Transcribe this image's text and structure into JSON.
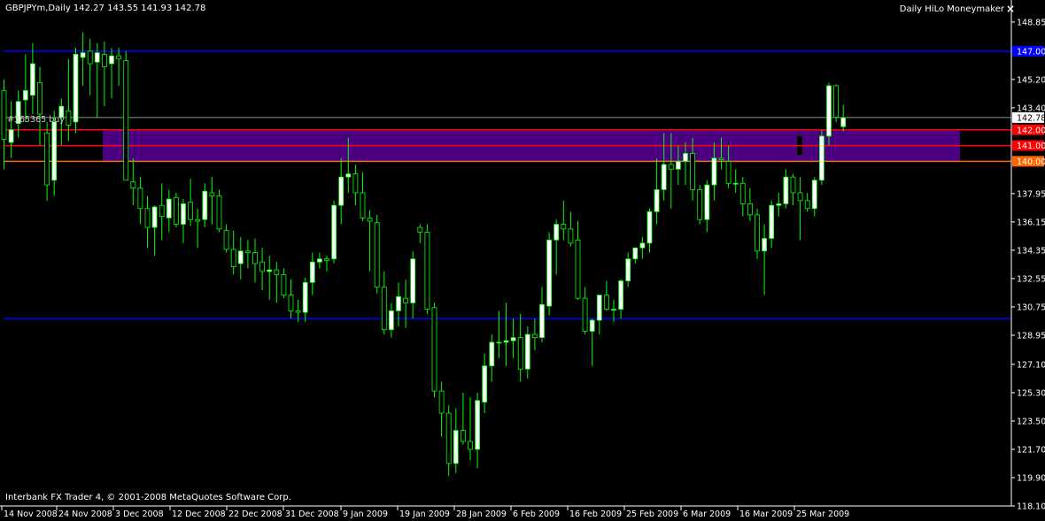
{
  "header": {
    "symbol_info": "GBPJPYm,Daily  142.27 143.55 141.93 142.78",
    "indicator_name": "Daily HiLo Moneymaker",
    "close_icon": "×"
  },
  "footer": {
    "copyright": "Interbank FX Trader 4, © 2001-2008 MetaQuotes Software Corp."
  },
  "trade_label": "#365365 buy",
  "colors": {
    "background": "#000000",
    "axis": "#ffffff",
    "bull_body": "#ffffff",
    "bear_body": "#000000",
    "candle_outline": "#00ff00",
    "level_blue": "#0000ff",
    "level_red": "#ff0000",
    "level_orange": "#ff6600",
    "zone_fill": "#4b0082",
    "current_price_line": "#c0c0c0"
  },
  "chart_data": {
    "type": "candlestick",
    "symbol": "GBPJPYm",
    "timeframe": "Daily",
    "ylim": [
      118.1,
      149.8
    ],
    "y_ticks": [
      "148.85",
      "147.00",
      "145.20",
      "143.40",
      "142.78",
      "142.00",
      "141.00",
      "140.00",
      "137.95",
      "136.15",
      "134.35",
      "132.55",
      "130.75",
      "128.95",
      "127.10",
      "125.30",
      "123.50",
      "121.70",
      "119.90",
      "118.10"
    ],
    "x_tick_labels": [
      "14 Nov 2008",
      "24 Nov 2008",
      "3 Dec 2008",
      "12 Dec 2008",
      "22 Dec 2008",
      "31 Dec 2008",
      "9 Jan 2009",
      "19 Jan 2009",
      "28 Jan 2009",
      "6 Feb 2009",
      "16 Feb 2009",
      "25 Feb 2009",
      "6 Mar 2009",
      "16 Mar 2009",
      "25 Mar 2009"
    ],
    "horizontal_levels": [
      {
        "price": 147.0,
        "label": "147.00",
        "color": "#0000ff"
      },
      {
        "price": 142.0,
        "label": "142.00",
        "color": "#ff0000"
      },
      {
        "price": 141.0,
        "label": "141.00",
        "color": "#ff0000"
      },
      {
        "price": 140.0,
        "label": "140.00",
        "color": "#ff6600"
      },
      {
        "price": 130.0,
        "label": "130.00",
        "color": "#0000ff"
      }
    ],
    "zone": {
      "from_price": 140.0,
      "to_price": 142.0
    },
    "current_price": 142.78,
    "ohlc": [
      [
        144.5,
        145.2,
        139.5,
        141.4
      ],
      [
        141.2,
        143.8,
        140.2,
        142.0
      ],
      [
        142.4,
        144.5,
        141.5,
        143.8
      ],
      [
        143.9,
        146.8,
        142.5,
        144.5
      ],
      [
        144.2,
        147.5,
        143.0,
        146.2
      ],
      [
        145.0,
        146.0,
        141.0,
        143.0
      ],
      [
        141.8,
        142.5,
        137.5,
        138.5
      ],
      [
        138.8,
        143.2,
        137.8,
        142.5
      ],
      [
        142.8,
        144.0,
        141.0,
        143.5
      ],
      [
        143.2,
        146.5,
        141.3,
        142.3
      ],
      [
        142.5,
        147.2,
        141.8,
        146.8
      ],
      [
        146.6,
        148.2,
        144.8,
        146.9
      ],
      [
        147.0,
        147.8,
        144.2,
        146.2
      ],
      [
        146.3,
        147.5,
        142.8,
        146.9
      ],
      [
        146.8,
        147.6,
        143.5,
        146.0
      ],
      [
        146.2,
        147.2,
        144.0,
        146.7
      ],
      [
        146.7,
        147.2,
        144.8,
        146.5
      ],
      [
        146.4,
        147.0,
        143.0,
        138.8
      ],
      [
        138.7,
        140.2,
        137.2,
        138.3
      ],
      [
        138.3,
        139.0,
        136.0,
        137.0
      ],
      [
        137.0,
        137.8,
        134.5,
        135.8
      ],
      [
        135.8,
        137.2,
        134.0,
        137.1
      ],
      [
        137.2,
        138.6,
        135.0,
        136.5
      ],
      [
        136.4,
        138.2,
        135.5,
        137.6
      ],
      [
        137.7,
        138.0,
        135.8,
        136.0
      ],
      [
        136.0,
        137.6,
        134.8,
        137.3
      ],
      [
        137.4,
        138.9,
        135.9,
        136.3
      ],
      [
        136.3,
        137.0,
        134.5,
        136.2
      ],
      [
        136.3,
        138.6,
        135.8,
        138.1
      ],
      [
        138.0,
        139.0,
        136.0,
        137.8
      ],
      [
        137.8,
        138.2,
        135.5,
        135.7
      ],
      [
        135.6,
        136.0,
        134.2,
        134.4
      ],
      [
        134.4,
        135.6,
        132.8,
        133.3
      ],
      [
        133.5,
        135.2,
        132.5,
        134.3
      ],
      [
        134.3,
        135.0,
        133.2,
        134.2
      ],
      [
        134.2,
        135.1,
        132.3,
        133.5
      ],
      [
        133.6,
        134.5,
        131.8,
        133.0
      ],
      [
        133.0,
        134.0,
        131.2,
        133.1
      ],
      [
        133.1,
        133.6,
        131.0,
        132.8
      ],
      [
        132.8,
        133.2,
        131.3,
        131.5
      ],
      [
        131.5,
        132.5,
        130.0,
        130.5
      ],
      [
        130.5,
        131.2,
        129.8,
        130.4
      ],
      [
        130.4,
        132.6,
        129.8,
        132.3
      ],
      [
        132.3,
        134.2,
        131.5,
        133.6
      ],
      [
        133.6,
        134.2,
        133.2,
        133.8
      ],
      [
        133.8,
        134.0,
        133.0,
        133.7
      ],
      [
        133.8,
        137.5,
        133.5,
        137.2
      ],
      [
        137.2,
        140.2,
        136.0,
        139.0
      ],
      [
        139.0,
        141.5,
        138.0,
        139.2
      ],
      [
        139.2,
        139.8,
        137.2,
        138.0
      ],
      [
        138.0,
        139.3,
        136.2,
        136.4
      ],
      [
        136.4,
        136.9,
        133.0,
        136.2
      ],
      [
        136.1,
        136.6,
        131.6,
        132.0
      ],
      [
        132.0,
        133.0,
        129.0,
        129.3
      ],
      [
        129.3,
        131.0,
        128.8,
        130.5
      ],
      [
        130.5,
        132.3,
        129.5,
        131.4
      ],
      [
        131.3,
        132.5,
        129.4,
        131.0
      ],
      [
        131.0,
        134.3,
        130.0,
        133.8
      ],
      [
        135.8,
        136.0,
        134.8,
        135.5
      ],
      [
        135.5,
        136.0,
        130.3,
        130.6
      ],
      [
        130.7,
        131.0,
        125.0,
        125.4
      ],
      [
        125.4,
        126.0,
        122.5,
        124.0
      ],
      [
        124.0,
        124.5,
        120.0,
        120.8
      ],
      [
        120.8,
        124.3,
        120.2,
        122.9
      ],
      [
        122.9,
        125.3,
        122.0,
        122.2
      ],
      [
        122.2,
        125.0,
        121.0,
        121.7
      ],
      [
        121.7,
        125.3,
        120.5,
        124.8
      ],
      [
        124.7,
        127.8,
        124.0,
        127.0
      ],
      [
        127.0,
        129.0,
        126.0,
        128.5
      ],
      [
        128.5,
        130.5,
        127.5,
        128.5
      ],
      [
        128.5,
        131.0,
        127.0,
        128.6
      ],
      [
        128.6,
        130.0,
        127.5,
        128.8
      ],
      [
        128.8,
        130.3,
        126.0,
        126.8
      ],
      [
        126.8,
        129.5,
        126.2,
        129.0
      ],
      [
        129.0,
        130.0,
        128.0,
        128.8
      ],
      [
        128.8,
        132.0,
        128.5,
        130.9
      ],
      [
        130.8,
        135.5,
        130.2,
        135.0
      ],
      [
        135.0,
        136.3,
        132.8,
        136.0
      ],
      [
        136.0,
        137.5,
        135.0,
        135.7
      ],
      [
        135.7,
        136.8,
        134.6,
        134.8
      ],
      [
        135.0,
        136.2,
        131.2,
        131.3
      ],
      [
        131.3,
        132.0,
        129.0,
        129.2
      ],
      [
        129.2,
        130.0,
        127.0,
        129.9
      ],
      [
        129.9,
        131.5,
        129.0,
        131.5
      ],
      [
        131.5,
        132.4,
        130.5,
        130.6
      ],
      [
        130.6,
        131.2,
        129.8,
        130.6
      ],
      [
        130.6,
        132.5,
        130.0,
        132.4
      ],
      [
        132.4,
        134.2,
        132.0,
        133.8
      ],
      [
        133.8,
        134.5,
        133.5,
        134.5
      ],
      [
        134.5,
        135.2,
        133.8,
        134.8
      ],
      [
        134.8,
        137.0,
        134.2,
        136.8
      ],
      [
        136.8,
        140.2,
        136.0,
        138.2
      ],
      [
        138.2,
        141.8,
        137.5,
        139.8
      ],
      [
        139.8,
        141.8,
        137.0,
        139.5
      ],
      [
        139.5,
        141.0,
        138.5,
        140.0
      ],
      [
        140.0,
        141.2,
        138.5,
        140.5
      ],
      [
        140.5,
        141.5,
        137.5,
        138.2
      ],
      [
        138.2,
        138.5,
        136.0,
        136.3
      ],
      [
        136.3,
        138.8,
        135.5,
        138.5
      ],
      [
        138.5,
        141.2,
        137.5,
        140.2
      ],
      [
        140.2,
        141.5,
        139.5,
        140.1
      ],
      [
        140.0,
        141.0,
        138.3,
        138.6
      ],
      [
        138.6,
        139.5,
        138.0,
        138.6
      ],
      [
        138.6,
        139.0,
        136.5,
        137.3
      ],
      [
        137.3,
        138.3,
        136.2,
        136.6
      ],
      [
        136.6,
        137.0,
        133.8,
        134.3
      ],
      [
        134.3,
        136.0,
        131.5,
        135.1
      ],
      [
        135.1,
        137.5,
        134.5,
        137.2
      ],
      [
        137.2,
        138.0,
        136.5,
        137.3
      ],
      [
        137.3,
        139.5,
        137.0,
        139.0
      ],
      [
        139.0,
        139.2,
        137.2,
        138.0
      ],
      [
        138.0,
        139.0,
        135.0,
        137.5
      ],
      [
        137.5,
        138.0,
        136.8,
        137.0
      ],
      [
        137.0,
        139.0,
        136.5,
        138.8
      ],
      [
        138.8,
        142.0,
        138.5,
        141.6
      ],
      [
        141.6,
        145.0,
        141.0,
        144.8
      ],
      [
        144.8,
        144.9,
        142.5,
        142.8
      ],
      [
        142.2,
        143.6,
        141.9,
        142.78
      ]
    ]
  }
}
